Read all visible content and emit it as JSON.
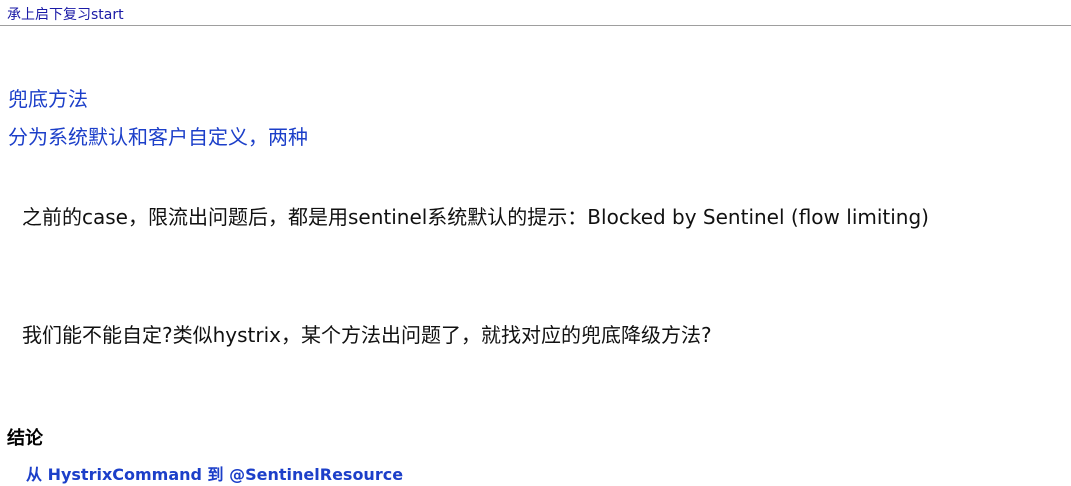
{
  "header": {
    "link_text": "承上启下复习start"
  },
  "section": {
    "title": "兜底方法",
    "subtitle": "分为系统默认和客户自定义，两种"
  },
  "paragraphs": [
    "之前的case，限流出问题后，都是用sentinel系统默认的提示：Blocked by Sentinel (flow limiting)",
    "我们能不能自定?类似hystrix，某个方法出问题了，就找对应的兜底降级方法?"
  ],
  "conclusion": {
    "heading": "结论",
    "text": "从 HystrixCommand 到 @SentinelResource"
  },
  "colors": {
    "link": "#1a1aa6",
    "accent_blue": "#1c3fc9",
    "body_text": "#111111",
    "rule": "#9e9e9e"
  }
}
